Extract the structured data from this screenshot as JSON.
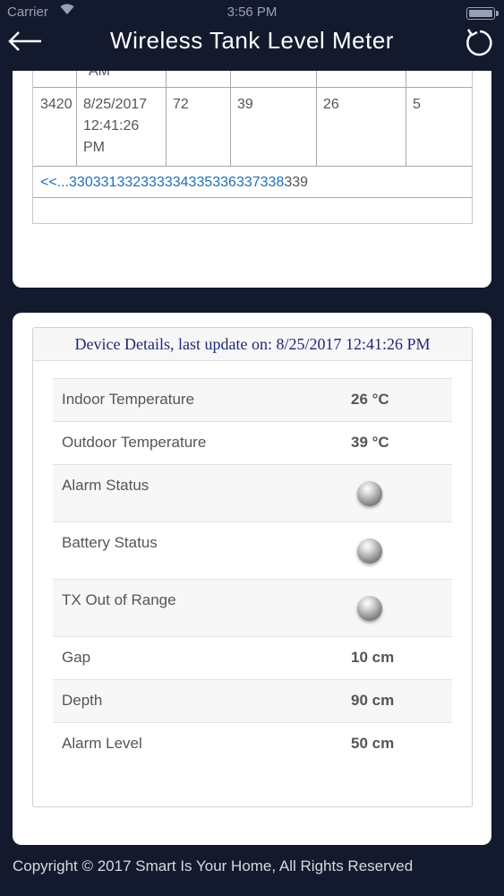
{
  "status_bar": {
    "carrier": "Carrier",
    "time": "3:56 PM"
  },
  "nav": {
    "title": "Wireless Tank Level Meter",
    "back_icon": "back-arrow-icon",
    "refresh_icon": "refresh-icon"
  },
  "history": {
    "partial_text": "AM",
    "row": {
      "id": "3420",
      "date_line1": "8/25/2017",
      "date_line2": "12:41:26",
      "date_line3": "PM",
      "v1": "72",
      "v2": "39",
      "v3": "26",
      "v4": "5"
    },
    "pager": {
      "links": [
        "<<...",
        "330",
        "331",
        "332",
        "333",
        "334",
        "335",
        "336",
        "337",
        "338"
      ],
      "current": "339"
    }
  },
  "device": {
    "header": "Device Details, last update on: 8/25/2017 12:41:26 PM",
    "rows": [
      {
        "label": "Indoor Temperature",
        "value": "26 °C"
      },
      {
        "label": "Outdoor Temperature",
        "value": "39 °C"
      },
      {
        "label": "Alarm Status",
        "indicator": "off"
      },
      {
        "label": "Battery Status",
        "indicator": "off"
      },
      {
        "label": "TX Out of Range",
        "indicator": "off"
      },
      {
        "label": "Gap",
        "value": "10 cm"
      },
      {
        "label": "Depth",
        "value": "90 cm"
      },
      {
        "label": "Alarm Level",
        "value": "50 cm"
      }
    ],
    "indicator_color": "#8a8a8a"
  },
  "footer": {
    "text": "Copyright © 2017 Smart Is Your Home, All Rights Reserved"
  },
  "colors": {
    "background": "#141a2e",
    "link": "#1e6fb5",
    "header_text": "#1c2a78"
  }
}
